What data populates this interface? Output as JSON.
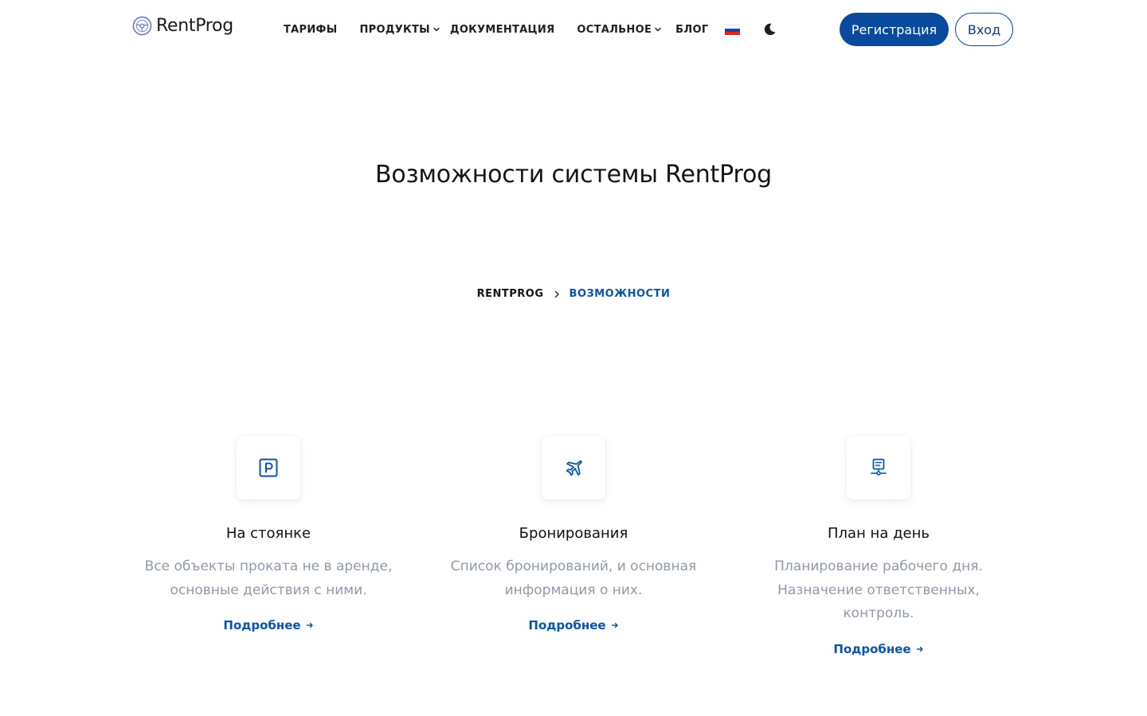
{
  "header": {
    "logo_text": "RentProg",
    "nav": [
      {
        "label": "ТАРИФЫ",
        "has_dropdown": false
      },
      {
        "label": "ПРОДУКТЫ",
        "has_dropdown": true
      },
      {
        "label": "ДОКУМЕНТАЦИЯ",
        "has_dropdown": false
      },
      {
        "label": "ОСТАЛЬНОЕ",
        "has_dropdown": true
      },
      {
        "label": "БЛОГ",
        "has_dropdown": false
      }
    ],
    "register_label": "Регистрация",
    "login_label": "Вход"
  },
  "page_title": "Возможности системы RentProg",
  "breadcrumb": {
    "root": "RENTPROG",
    "current": "ВОЗМОЖНОСТИ"
  },
  "features": [
    {
      "icon": "parking-icon",
      "title": "На стоянке",
      "description": "Все объекты проката не в аренде, основные действия с ними.",
      "link": "Подробнее"
    },
    {
      "icon": "airplane-icon",
      "title": "Бронирования",
      "description": "Список бронирований, и основная информация о них.",
      "link": "Подробнее"
    },
    {
      "icon": "daily-plan-icon",
      "title": "План на день",
      "description": "Планирование рабочего дня. Назначение ответственных, контроль.",
      "link": "Подробнее"
    }
  ],
  "colors": {
    "accent": "#0a4a9c",
    "text_dark": "#111111",
    "text_muted": "#8f9aa8",
    "border": "#0a4a9c",
    "flag_white": "#ffffff",
    "flag_blue": "#1c3fa8",
    "flag_red": "#d52b1e"
  }
}
